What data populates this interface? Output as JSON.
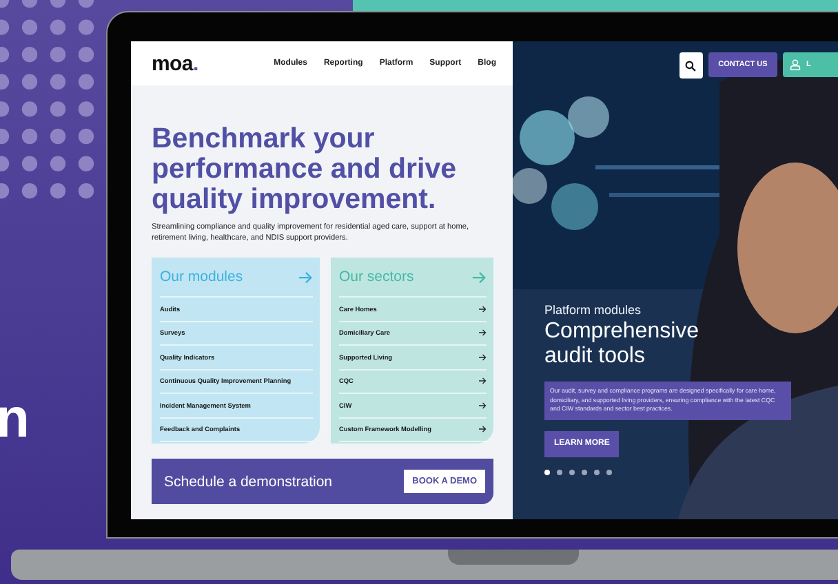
{
  "backdrop": {
    "headline_fragment": "n"
  },
  "header": {
    "logo": "moa.",
    "nav": [
      "Modules",
      "Reporting",
      "Platform",
      "Support",
      "Blog"
    ],
    "contact_button": "CONTACT US",
    "login_button": "L"
  },
  "hero": {
    "headline": "Benchmark your performance and drive quality improvement.",
    "subtitle": "Streamlining compliance and quality improvement for residential aged care, support at home, retirement living, healthcare, and NDIS support providers."
  },
  "cards": [
    {
      "kind": "modules",
      "title": "Our modules",
      "items": [
        "Audits",
        "Surveys",
        "Quality Indicators",
        "Continuous Quality Improvement Planning",
        "Incident Management System",
        "Feedback and Complaints"
      ]
    },
    {
      "kind": "sectors",
      "title": "Our sectors",
      "items": [
        "Care Homes",
        "Domiciliary Care",
        "Supported Living",
        "CQC",
        "CIW",
        "Custom Framework Modelling"
      ]
    }
  ],
  "demo_bar": {
    "text": "Schedule a demonstration",
    "button": "BOOK A DEMO"
  },
  "slide": {
    "eyebrow": "Platform modules",
    "title": "Comprehensive audit tools",
    "description": "Our audit, survey and compliance programs are designed specifically for care home, domiciliary, and supported living providers, ensuring compliance with the latest CQC and CIW standards and sector best practices.",
    "button": "LEARN MORE",
    "dots": [
      {
        "selected": true
      },
      {
        "selected": false
      },
      {
        "selected": false
      },
      {
        "selected": false
      },
      {
        "selected": false
      },
      {
        "selected": false
      }
    ]
  }
}
